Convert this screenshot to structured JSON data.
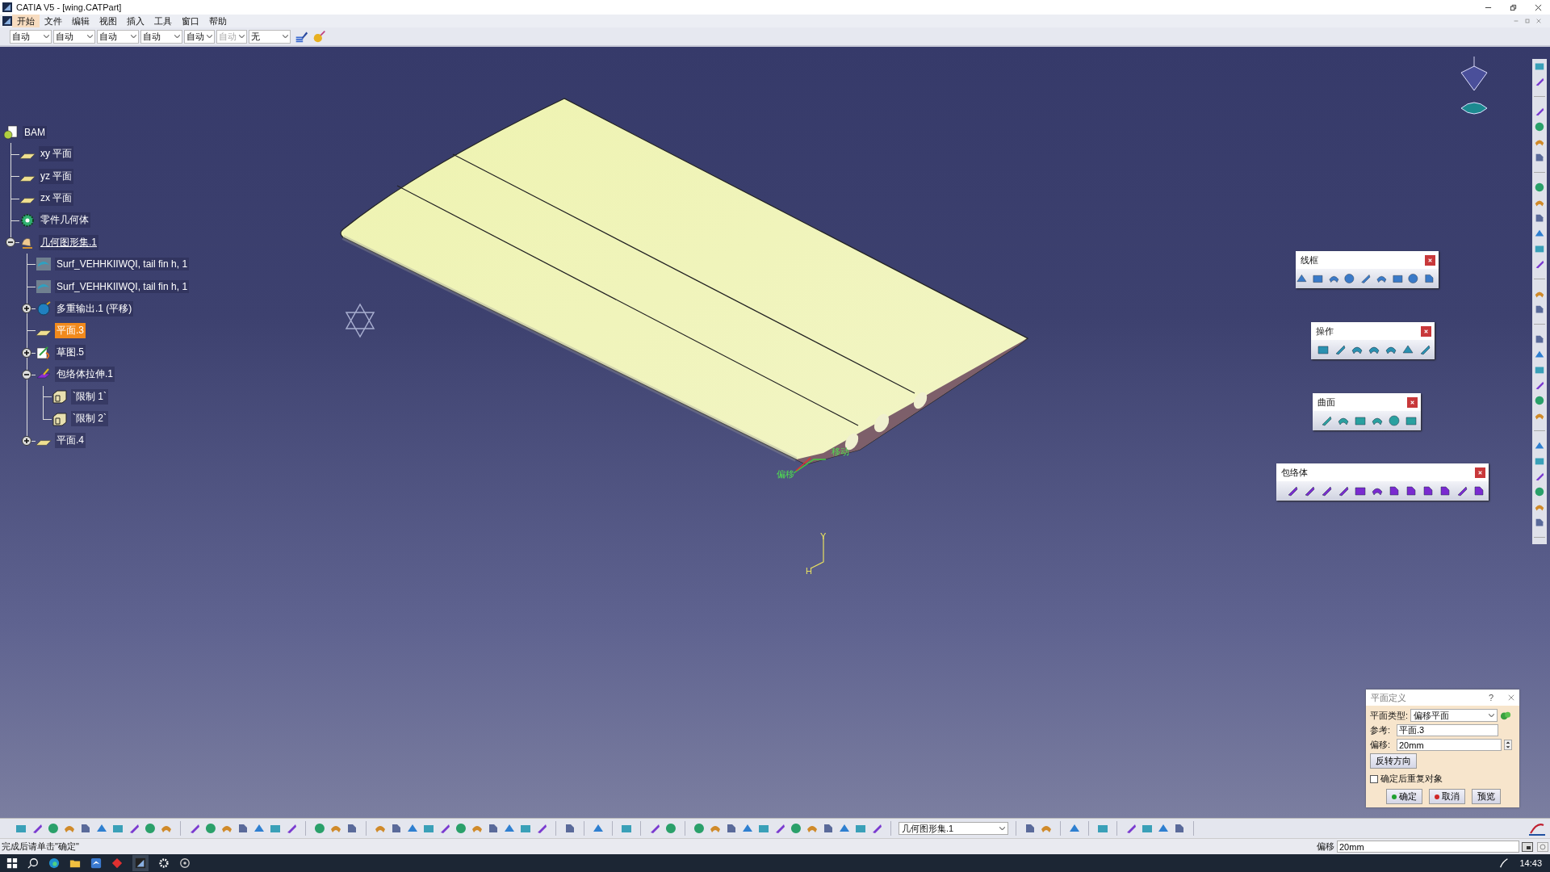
{
  "window": {
    "title": "CATIA V5 - [wing.CATPart]"
  },
  "menu": [
    {
      "label": "开始",
      "selected": true
    },
    {
      "label": "文件",
      "selected": false
    },
    {
      "label": "编辑",
      "selected": false
    },
    {
      "label": "视图",
      "selected": false
    },
    {
      "label": "插入",
      "selected": false
    },
    {
      "label": "工具",
      "selected": false
    },
    {
      "label": "窗口",
      "selected": false
    },
    {
      "label": "帮助",
      "selected": false
    }
  ],
  "style_toolbar": [
    {
      "value": "自动",
      "disabled": false
    },
    {
      "value": "自动",
      "disabled": false
    },
    {
      "value": "自动",
      "disabled": false
    },
    {
      "value": "自动",
      "disabled": false
    },
    {
      "value": "自动",
      "disabled": false
    },
    {
      "value": "自动",
      "disabled": true
    },
    {
      "value": "无",
      "disabled": false
    }
  ],
  "tree": {
    "label": "BAM",
    "kind": "root",
    "selected": false,
    "current": false,
    "children": [
      {
        "label": "xy 平面",
        "kind": "plane",
        "selected": false,
        "current": false
      },
      {
        "label": "yz 平面",
        "kind": "plane",
        "selected": false,
        "current": false
      },
      {
        "label": "zx 平面",
        "kind": "plane",
        "selected": false,
        "current": false
      },
      {
        "label": "零件几何体",
        "kind": "body",
        "selected": false,
        "current": false
      },
      {
        "label": "几何图形集.1",
        "kind": "geoset",
        "selected": false,
        "current": true,
        "expanded": true,
        "children": [
          {
            "label": "Surf_VEHHKIIWQI, tail fin h, 1",
            "kind": "surface",
            "selected": false,
            "current": false
          },
          {
            "label": "Surf_VEHHKIIWQI, tail fin h, 1",
            "kind": "surface",
            "selected": false,
            "current": false
          },
          {
            "label": "多重输出.1 (平移)",
            "kind": "multi",
            "selected": false,
            "current": false,
            "expanded": false
          },
          {
            "label": "平面.3",
            "kind": "plane",
            "selected": true,
            "current": false
          },
          {
            "label": "草图.5",
            "kind": "sketch",
            "selected": false,
            "current": false,
            "expanded": false
          },
          {
            "label": "包络体拉伸.1",
            "kind": "extrude",
            "selected": false,
            "current": false,
            "expanded": true,
            "children": [
              {
                "label": "`限制 1`",
                "kind": "limit",
                "selected": false,
                "current": false
              },
              {
                "label": "`限制 2`",
                "kind": "limit",
                "selected": false,
                "current": false
              }
            ]
          },
          {
            "label": "平面.4",
            "kind": "plane",
            "selected": false,
            "current": false,
            "expanded": false
          }
        ]
      }
    ]
  },
  "viewport_labels": {
    "offset": "偏移",
    "move": "移动",
    "axis_y": "Y",
    "axis_h": "H"
  },
  "floating_toolbars": [
    {
      "title": "线框"
    },
    {
      "title": "操作"
    },
    {
      "title": "曲面"
    },
    {
      "title": "包络体"
    }
  ],
  "dialog": {
    "title": "平面定义",
    "help": "?",
    "type_label": "平面类型:",
    "type_value": "偏移平面",
    "ref_label": "参考:",
    "ref_value": "平面.3",
    "offset_label": "偏移:",
    "offset_value": "20mm",
    "reverse_button": "反转方向",
    "repeat_label": "确定后重复对象",
    "repeat_checked": false,
    "ok": "确定",
    "cancel": "取消",
    "preview": "预览"
  },
  "bottom_toolbar": {
    "combo": "几何图形集.1"
  },
  "status_bar": {
    "message": "完成后请单击\"确定\"",
    "field_label": "偏移",
    "field_value": "20mm"
  },
  "taskbar": {
    "time": "14:43"
  }
}
